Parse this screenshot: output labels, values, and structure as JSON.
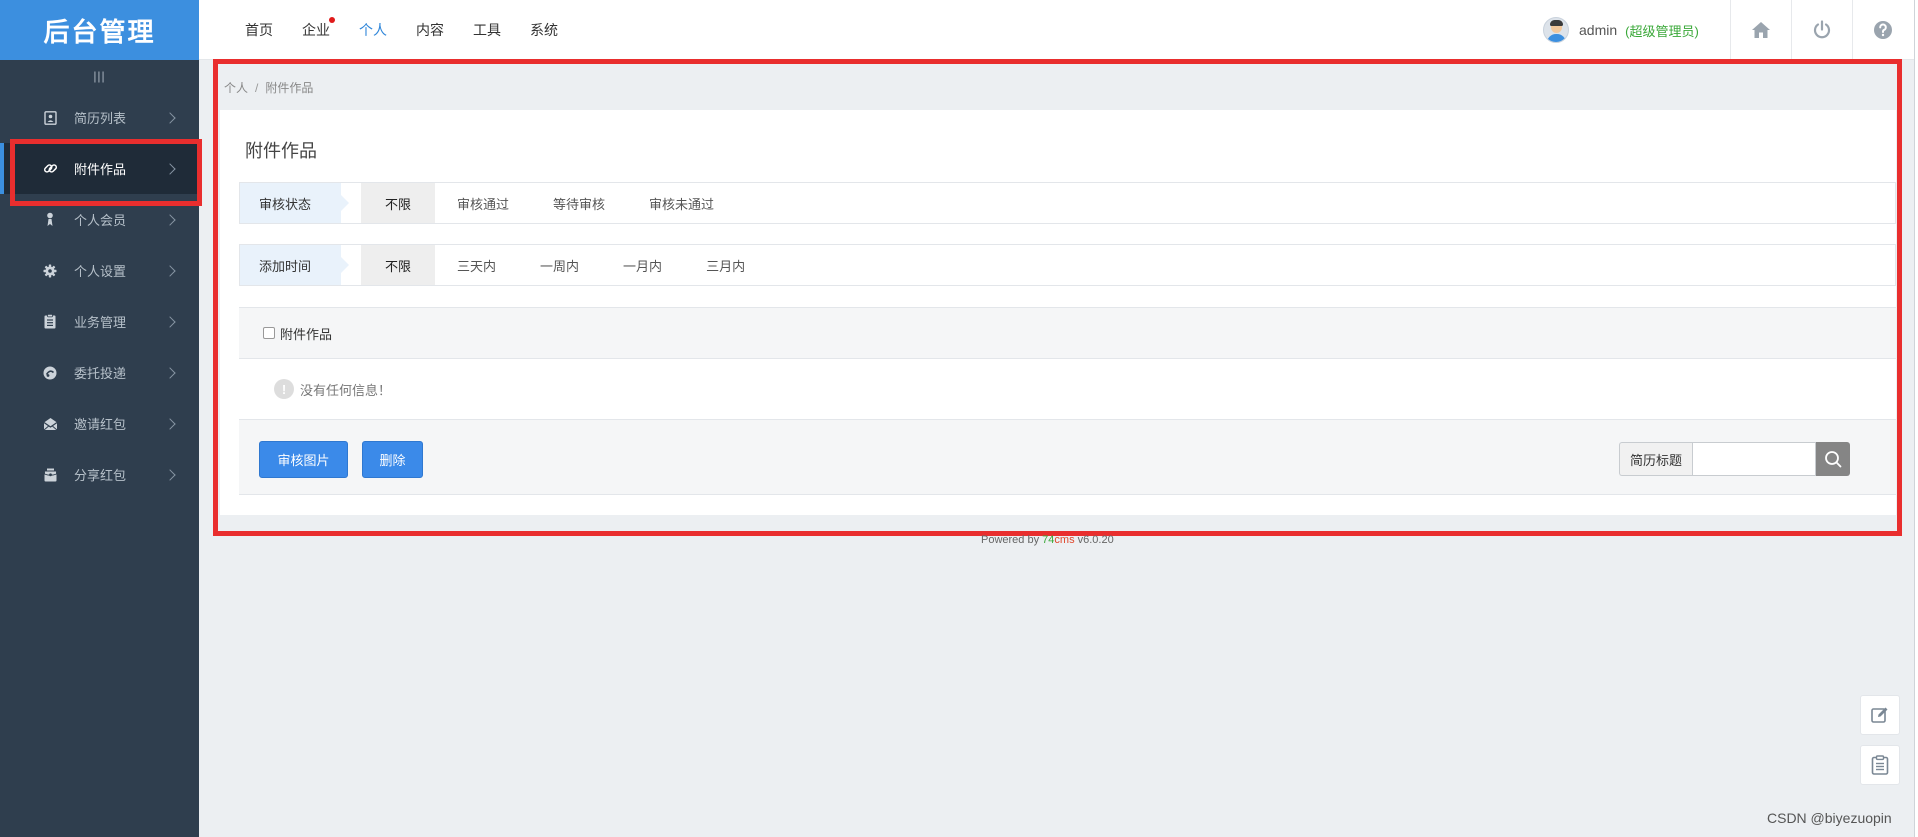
{
  "app": {
    "logo_text": "后台管理"
  },
  "topnav": {
    "items": [
      {
        "label": "首页",
        "active": false,
        "badge": false
      },
      {
        "label": "企业",
        "active": false,
        "badge": true
      },
      {
        "label": "个人",
        "active": true,
        "badge": false
      },
      {
        "label": "内容",
        "active": false,
        "badge": false
      },
      {
        "label": "工具",
        "active": false,
        "badge": false
      },
      {
        "label": "系统",
        "active": false,
        "badge": false
      }
    ]
  },
  "user": {
    "name": "admin",
    "role": "(超级管理员)"
  },
  "top_icons": [
    "home-icon",
    "power-icon",
    "help-icon"
  ],
  "sidebar": {
    "collapse_glyph": "|||",
    "items": [
      {
        "label": "简历列表",
        "icon": "resume-icon",
        "active": false
      },
      {
        "label": "附件作品",
        "icon": "link-icon",
        "active": true
      },
      {
        "label": "个人会员",
        "icon": "member-icon",
        "active": false
      },
      {
        "label": "个人设置",
        "icon": "gear-icon",
        "active": false
      },
      {
        "label": "业务管理",
        "icon": "clipboard-icon",
        "active": false
      },
      {
        "label": "委托投递",
        "icon": "delegate-icon",
        "active": false
      },
      {
        "label": "邀请红包",
        "icon": "envelope-icon",
        "active": false
      },
      {
        "label": "分享红包",
        "icon": "gift-icon",
        "active": false
      }
    ]
  },
  "breadcrumb": {
    "parent": "个人",
    "separator": "/",
    "current": "附件作品"
  },
  "page": {
    "title": "附件作品"
  },
  "filters": {
    "status": {
      "label": "审核状态",
      "options": [
        "不限",
        "审核通过",
        "等待审核",
        "审核未通过"
      ],
      "selected": "不限"
    },
    "time": {
      "label": "添加时间",
      "options": [
        "不限",
        "三天内",
        "一周内",
        "一月内",
        "三月内"
      ],
      "selected": "不限"
    }
  },
  "list": {
    "select_all_label": "附件作品",
    "empty_message": "没有任何信息！"
  },
  "actions": {
    "audit_label": "审核图片",
    "delete_label": "删除"
  },
  "search": {
    "label": "简历标题",
    "value": ""
  },
  "footer": {
    "prefix": "Powered by ",
    "brand_a": "74",
    "brand_b": "cms",
    "version": " v6.0.20"
  },
  "watermark": "CSDN @biyezuopin",
  "colors": {
    "accent": "#3c8fdf",
    "sidebar_bg": "#2f3e4e",
    "highlight": "#e92e2e",
    "role_green": "#3aa838"
  }
}
